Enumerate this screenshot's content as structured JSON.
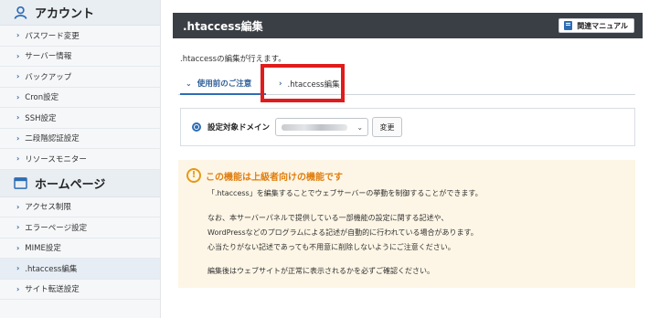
{
  "sidebar": {
    "account": {
      "title": "アカウント",
      "items": [
        "パスワード変更",
        "サーバー情報",
        "バックアップ",
        "Cron設定",
        "SSH設定",
        "二段階認証設定",
        "リソースモニター"
      ]
    },
    "homepage": {
      "title": "ホームページ",
      "items": [
        "アクセス制限",
        "エラーページ設定",
        "MIME設定",
        ".htaccess編集",
        "サイト転送設定"
      ]
    }
  },
  "header": {
    "title": ".htaccess編集",
    "manual_label": "関連マニュアル"
  },
  "description": ".htaccessの編集が行えます。",
  "tabs": [
    {
      "label": "使用前のご注意"
    },
    {
      "label": ".htaccess編集"
    }
  ],
  "domain": {
    "label": "設定対象ドメイン",
    "change_label": "変更"
  },
  "warning": {
    "title": "この機能は上級者向けの機能です",
    "lines": [
      "「.htaccess」を編集することでウェブサーバーの挙動を制御することができます。",
      "なお、本サーバーパネルで提供している一部機能の設定に関する記述や、",
      "WordPressなどのプログラムによる記述が自動的に行われている場合があります。",
      "心当たりがない記述であっても不用意に削除しないようにご注意ください。",
      "編集後はウェブサイトが正常に表示されるかを必ずご確認ください。"
    ]
  },
  "colors": {
    "header_bg": "#3a3f45",
    "accent": "#2e6db4",
    "highlight": "#e01b1b",
    "warning": "#e07e0f",
    "warning_bg": "#fdf6e6"
  }
}
